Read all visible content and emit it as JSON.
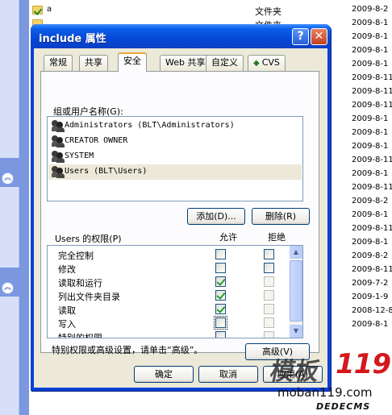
{
  "background": {
    "rows": [
      {
        "name": "a",
        "type": "文件夹",
        "date": "2009-8-2"
      },
      {
        "name": "",
        "type": "文件夹",
        "date": "2009-8-1"
      },
      {
        "name": "",
        "type": "",
        "date": "2009-8-1"
      },
      {
        "name": "",
        "type": "",
        "date": "2009-8-1"
      },
      {
        "name": "",
        "type": "",
        "date": "2009-8-1"
      },
      {
        "name": "",
        "type": "",
        "date": "2009-8-11"
      },
      {
        "name": "",
        "type": "",
        "date": "2009-8-11"
      },
      {
        "name": "",
        "type": "",
        "date": "2009-8-11"
      },
      {
        "name": "",
        "type": "",
        "date": "2009-8-1"
      },
      {
        "name": "",
        "type": "",
        "date": "2009-8-1"
      },
      {
        "name": "",
        "type": "",
        "date": "2009-8-1"
      },
      {
        "name": "",
        "type": "",
        "date": "2009-8-11"
      },
      {
        "name": "",
        "type": "",
        "date": "2009-8-1"
      },
      {
        "name": "",
        "type": "",
        "date": "2009-8-11"
      },
      {
        "name": "",
        "type": "",
        "date": "2009-8-2"
      },
      {
        "name": "",
        "type": "",
        "date": "2009-8-1"
      },
      {
        "name": "",
        "type": "",
        "date": "2009-8-11"
      },
      {
        "name": "",
        "type": "",
        "date": "2009-8-1"
      },
      {
        "name": "",
        "type": "",
        "date": "2009-8-2"
      },
      {
        "name": "",
        "type": "",
        "date": "2009-8-11"
      },
      {
        "name": "",
        "type": "",
        "date": "2009-7-2"
      },
      {
        "name": "",
        "type": "",
        "date": "2009-1-9"
      },
      {
        "name": "",
        "type": "",
        "date": "2008-12-8"
      },
      {
        "name": "",
        "type": "",
        "date": "2009-8-1"
      }
    ]
  },
  "dialog": {
    "title": "include 属性",
    "help_glyph": "?",
    "close_glyph": "✕",
    "tabs": [
      {
        "label": "常规"
      },
      {
        "label": "共享"
      },
      {
        "label": "安全"
      },
      {
        "label": "Web 共享"
      },
      {
        "label": "自定义"
      },
      {
        "label": "CVS"
      }
    ],
    "group_label": "组或用户名称(G):",
    "users": [
      "Administrators (BLT\\Administrators)",
      "CREATOR OWNER",
      "SYSTEM",
      "Users (BLT\\Users)"
    ],
    "add_button": "添加(D)...",
    "remove_button": "删除(R)",
    "perm_label": "Users 的权限(P)",
    "allow_header": "允许",
    "deny_header": "拒绝",
    "permissions": [
      {
        "name": "完全控制",
        "allow": false,
        "deny": false
      },
      {
        "name": "修改",
        "allow": false,
        "deny": false
      },
      {
        "name": "读取和运行",
        "allow": true,
        "deny": false
      },
      {
        "name": "列出文件夹目录",
        "allow": true,
        "deny": false
      },
      {
        "name": "读取",
        "allow": true,
        "deny": false
      },
      {
        "name": "写入",
        "allow": false,
        "deny": false
      },
      {
        "name": "特别的权限",
        "allow": false,
        "deny": false
      }
    ],
    "advanced_hint": "特别权限或高级设置，请单击“高级”。",
    "advanced_button": "高级(V)",
    "ok_button": "确定",
    "cancel_button": "取消",
    "apply_button": "应用(A)"
  },
  "watermark": {
    "brand_cn": "模板",
    "brand_num": "119",
    "site": "moban119.com",
    "engine": "DEDECMS"
  }
}
